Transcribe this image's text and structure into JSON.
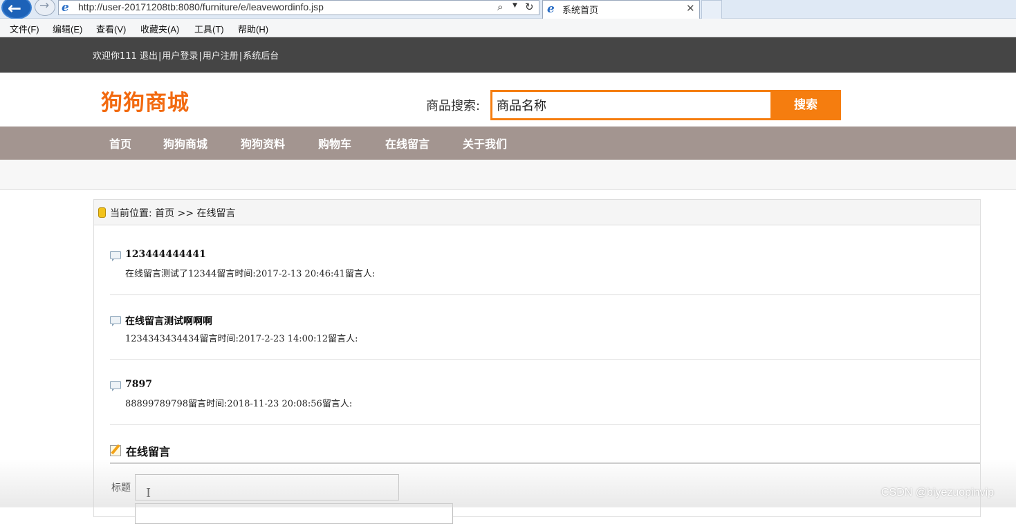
{
  "browser": {
    "url": "http://user-20171208tb:8080/furniture/e/leavewordinfo.jsp",
    "tab_title": "系统首页",
    "menu": [
      "文件(F)",
      "编辑(E)",
      "查看(V)",
      "收藏夹(A)",
      "工具(T)",
      "帮助(H)"
    ]
  },
  "topbar": {
    "welcome": "欢迎你111",
    "logout": "退出",
    "login": "用户登录",
    "register": "用户注册",
    "admin": "系统后台",
    "separator": "|"
  },
  "header": {
    "logo": "狗狗商城",
    "search_label": "商品搜索:",
    "search_value": "商品名称",
    "search_button": "搜索"
  },
  "nav": [
    "首页",
    "狗狗商城",
    "狗狗资料",
    "购物车",
    "在线留言",
    "关于我们"
  ],
  "breadcrumb": "当前位置: 首页 >> 在线留言",
  "messages": [
    {
      "title": "123444444441",
      "body": "在线留言测试了12344留言时间:2017-2-13 20:46:41留言人:"
    },
    {
      "title": "在线留言测试啊啊啊",
      "body": "1234343434434留言时间:2017-2-23 14:00:12留言人:"
    },
    {
      "title": "7897",
      "body": "88899789798留言时间:2018-11-23 20:08:56留言人:"
    }
  ],
  "form": {
    "title": "在线留言",
    "title_label": "标题"
  },
  "watermark": "CSDN @biyezuopinvip",
  "colors": {
    "accent": "#f57d0f",
    "logo": "#f26a10",
    "topbar": "#454545",
    "nav": "#a39590"
  }
}
